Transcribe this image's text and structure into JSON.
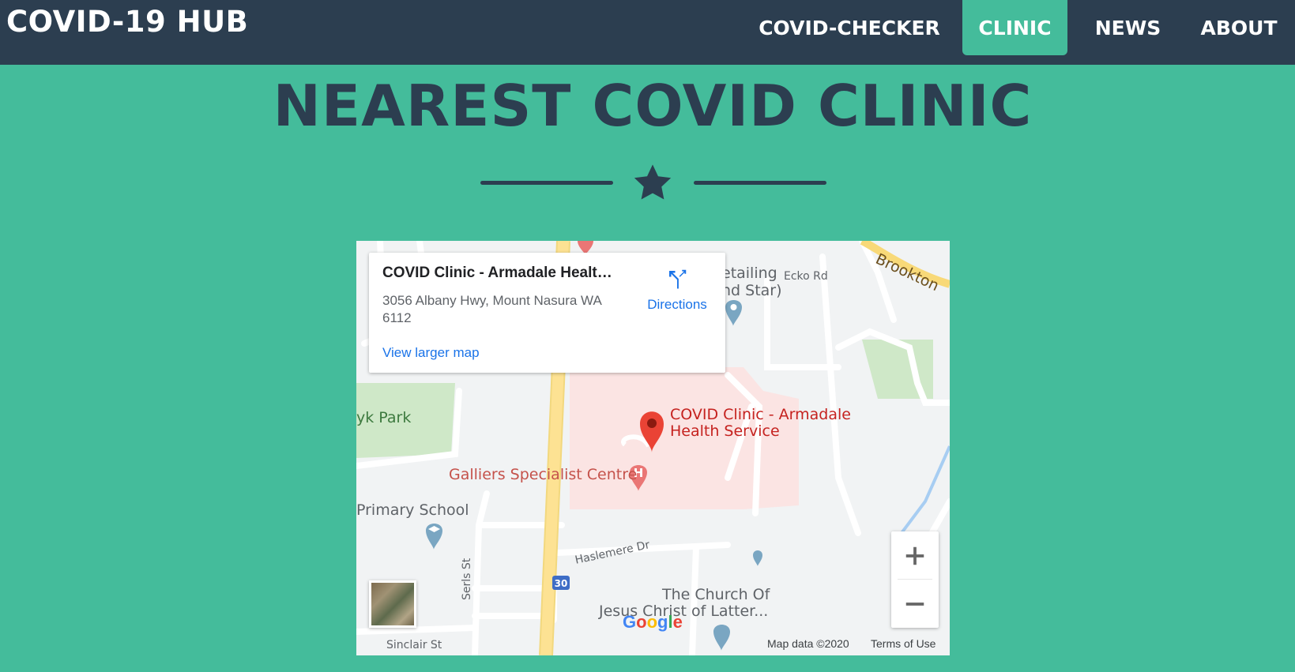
{
  "header": {
    "brand": "COVID-19 HUB",
    "nav": [
      {
        "label": "COVID-CHECKER"
      },
      {
        "label": "CLINIC"
      },
      {
        "label": "NEWS"
      },
      {
        "label": "ABOUT"
      }
    ],
    "active_nav": "CLINIC"
  },
  "page": {
    "title": "NEAREST COVID CLINIC"
  },
  "map": {
    "info_card": {
      "place_name": "COVID Clinic - Armadale Health Service",
      "address": "3056 Albany Hwy, Mount Nasura WA 6112",
      "directions_label": "Directions",
      "view_larger_label": "View larger map"
    },
    "marker_label": "COVID Clinic - Armadale Health Service",
    "labels": {
      "retailing": "etailing",
      "and_star": "nd Star)",
      "ecko_rd": "Ecko Rd",
      "brookton": "Brookton",
      "park": "yk Park",
      "galliers": "Galliers Specialist Centre",
      "primary_school": "Primary School",
      "haslemere": "Haslemere Dr",
      "serls": "Serls St",
      "sinclair": "Sinclair St",
      "church_line1": "The Church Of",
      "church_line2": "Jesus Christ of Latter...",
      "highway_shield": "30"
    },
    "google_logo": "Google",
    "map_data": "Map data ©2020",
    "terms": "Terms of Use",
    "zoom_in": "+",
    "zoom_out": "−"
  },
  "colors": {
    "background": "#44bc9b",
    "navbar": "#2c3e50",
    "accent": "#44bc9b",
    "marker": "#ea4335",
    "link": "#1a73e8"
  }
}
